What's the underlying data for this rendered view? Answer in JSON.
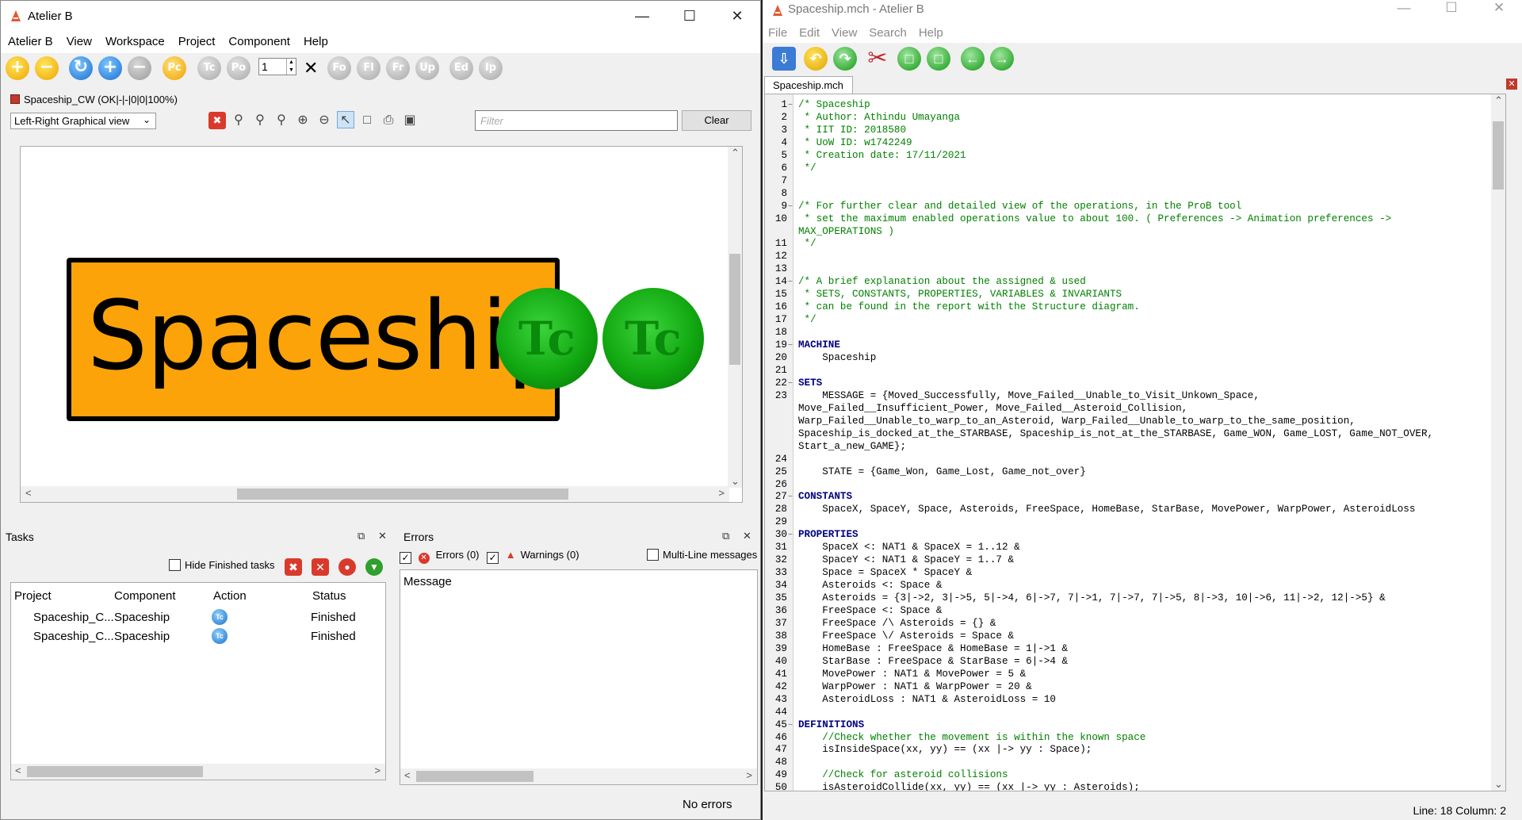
{
  "left_window": {
    "title": "Atelier B",
    "menu": [
      "Atelier B",
      "View",
      "Workspace",
      "Project",
      "Component",
      "Help"
    ],
    "toolbar": {
      "buttons": [
        "Pc",
        "Tc",
        "Po",
        "Fo",
        "Fl",
        "Fr",
        "Up",
        "Ed",
        "Ip"
      ],
      "spin_value": "1"
    },
    "project_status": "Spaceship_CW (OK|-|-|0|0|100%)",
    "view_mode": "Left-Right Graphical view",
    "filter_placeholder": "Filter",
    "clear_label": "Clear",
    "graph": {
      "machine_name": "Spaceship",
      "badges": [
        "Tc",
        "Tc"
      ],
      "box_color": "#fca30a"
    },
    "tasks": {
      "title": "Tasks",
      "hide_finished_label": "Hide Finished tasks",
      "columns": [
        "Project",
        "Component",
        "Action",
        "Status"
      ],
      "rows": [
        {
          "project": "Spaceship_C...",
          "component": "Spaceship",
          "action": "Tc",
          "status": "Finished"
        },
        {
          "project": "Spaceship_C...",
          "component": "Spaceship",
          "action": "Tc",
          "status": "Finished"
        }
      ]
    },
    "errors": {
      "title": "Errors",
      "errors_label": "Errors (0)",
      "warnings_label": "Warnings (0)",
      "multiline_label": "Multi-Line messages",
      "message_header": "Message",
      "footer": "No errors"
    }
  },
  "right_window": {
    "title": "Spaceship.mch - Atelier B",
    "menu": [
      "File",
      "Edit",
      "View",
      "Search",
      "Help"
    ],
    "tab": "Spaceship.mch",
    "status": "Line: 18 Column: 2",
    "code_lines": [
      {
        "n": "1",
        "t": "/* Spaceship",
        "c": "cm"
      },
      {
        "n": "2",
        "t": " * Author: Athindu Umayanga",
        "c": "cm"
      },
      {
        "n": "3",
        "t": " * IIT ID: 2018580",
        "c": "cm"
      },
      {
        "n": "4",
        "t": " * UoW ID: w1742249",
        "c": "cm"
      },
      {
        "n": "5",
        "t": " * Creation date: 17/11/2021",
        "c": "cm"
      },
      {
        "n": "6",
        "t": " */",
        "c": "cm"
      },
      {
        "n": "7",
        "t": "",
        "c": ""
      },
      {
        "n": "8",
        "t": "",
        "c": ""
      },
      {
        "n": "9",
        "t": "/* For further clear and detailed view of the operations, in the ProB tool",
        "c": "cm"
      },
      {
        "n": "10",
        "t": " * set the maximum enabled operations value to about 100. ( Preferences -> Animation preferences ->",
        "c": "cm"
      },
      {
        "n": "",
        "t": "MAX_OPERATIONS )",
        "c": "cm"
      },
      {
        "n": "11",
        "t": " */",
        "c": "cm"
      },
      {
        "n": "12",
        "t": "",
        "c": ""
      },
      {
        "n": "13",
        "t": "",
        "c": ""
      },
      {
        "n": "14",
        "t": "/* A brief explanation about the assigned & used",
        "c": "cm"
      },
      {
        "n": "15",
        "t": " * SETS, CONSTANTS, PROPERTIES, VARIABLES & INVARIANTS",
        "c": "cm"
      },
      {
        "n": "16",
        "t": " * can be found in the report with the Structure diagram.",
        "c": "cm"
      },
      {
        "n": "17",
        "t": " */",
        "c": "cm"
      },
      {
        "n": "18",
        "t": "",
        "c": ""
      },
      {
        "n": "19",
        "t": "MACHINE",
        "c": "kw"
      },
      {
        "n": "20",
        "t": "    Spaceship",
        "c": ""
      },
      {
        "n": "21",
        "t": "",
        "c": ""
      },
      {
        "n": "22",
        "t": "SETS",
        "c": "kw"
      },
      {
        "n": "23",
        "t": "    MESSAGE = {Moved_Successfully, Move_Failed__Unable_to_Visit_Unkown_Space,",
        "c": ""
      },
      {
        "n": "",
        "t": "Move_Failed__Insufficient_Power, Move_Failed__Asteroid_Collision,",
        "c": ""
      },
      {
        "n": "",
        "t": "Warp_Failed__Unable_to_warp_to_an_Asteroid, Warp_Failed__Unable_to_warp_to_the_same_position,",
        "c": ""
      },
      {
        "n": "",
        "t": "Spaceship_is_docked_at_the_STARBASE, Spaceship_is_not_at_the_STARBASE, Game_WON, Game_LOST, Game_NOT_OVER,",
        "c": ""
      },
      {
        "n": "",
        "t": "Start_a_new_GAME};",
        "c": ""
      },
      {
        "n": "24",
        "t": "",
        "c": ""
      },
      {
        "n": "25",
        "t": "    STATE = {Game_Won, Game_Lost, Game_not_over}",
        "c": ""
      },
      {
        "n": "26",
        "t": "",
        "c": ""
      },
      {
        "n": "27",
        "t": "CONSTANTS",
        "c": "kw"
      },
      {
        "n": "28",
        "t": "    SpaceX, SpaceY, Space, Asteroids, FreeSpace, HomeBase, StarBase, MovePower, WarpPower, AsteroidLoss",
        "c": ""
      },
      {
        "n": "29",
        "t": "",
        "c": ""
      },
      {
        "n": "30",
        "t": "PROPERTIES",
        "c": "kw"
      },
      {
        "n": "31",
        "t": "    SpaceX <: NAT1 & SpaceX = 1..12 &",
        "c": ""
      },
      {
        "n": "32",
        "t": "    SpaceY <: NAT1 & SpaceY = 1..7 &",
        "c": ""
      },
      {
        "n": "33",
        "t": "    Space = SpaceX * SpaceY &",
        "c": ""
      },
      {
        "n": "34",
        "t": "    Asteroids <: Space &",
        "c": ""
      },
      {
        "n": "35",
        "t": "    Asteroids = {3|->2, 3|->5, 5|->4, 6|->7, 7|->1, 7|->7, 7|->5, 8|->3, 10|->6, 11|->2, 12|->5} &",
        "c": ""
      },
      {
        "n": "36",
        "t": "    FreeSpace <: Space &",
        "c": ""
      },
      {
        "n": "37",
        "t": "    FreeSpace /\\ Asteroids = {} &",
        "c": ""
      },
      {
        "n": "38",
        "t": "    FreeSpace \\/ Asteroids = Space &",
        "c": ""
      },
      {
        "n": "39",
        "t": "    HomeBase : FreeSpace & HomeBase = 1|->1 &",
        "c": ""
      },
      {
        "n": "40",
        "t": "    StarBase : FreeSpace & StarBase = 6|->4 &",
        "c": ""
      },
      {
        "n": "41",
        "t": "    MovePower : NAT1 & MovePower = 5 &",
        "c": ""
      },
      {
        "n": "42",
        "t": "    WarpPower : NAT1 & WarpPower = 20 &",
        "c": ""
      },
      {
        "n": "43",
        "t": "    AsteroidLoss : NAT1 & AsteroidLoss = 10",
        "c": ""
      },
      {
        "n": "44",
        "t": "",
        "c": ""
      },
      {
        "n": "45",
        "t": "DEFINITIONS",
        "c": "kw"
      },
      {
        "n": "46",
        "t": "    //Check whether the movement is within the known space",
        "c": "cm"
      },
      {
        "n": "47",
        "t": "    isInsideSpace(xx, yy) == (xx |-> yy : Space);",
        "c": ""
      },
      {
        "n": "48",
        "t": "",
        "c": ""
      },
      {
        "n": "49",
        "t": "    //Check for asteroid collisions",
        "c": "cm"
      },
      {
        "n": "50",
        "t": "    isAsteroidCollide(xx, yy) == (xx |-> yy : Asteroids);",
        "c": ""
      }
    ]
  }
}
